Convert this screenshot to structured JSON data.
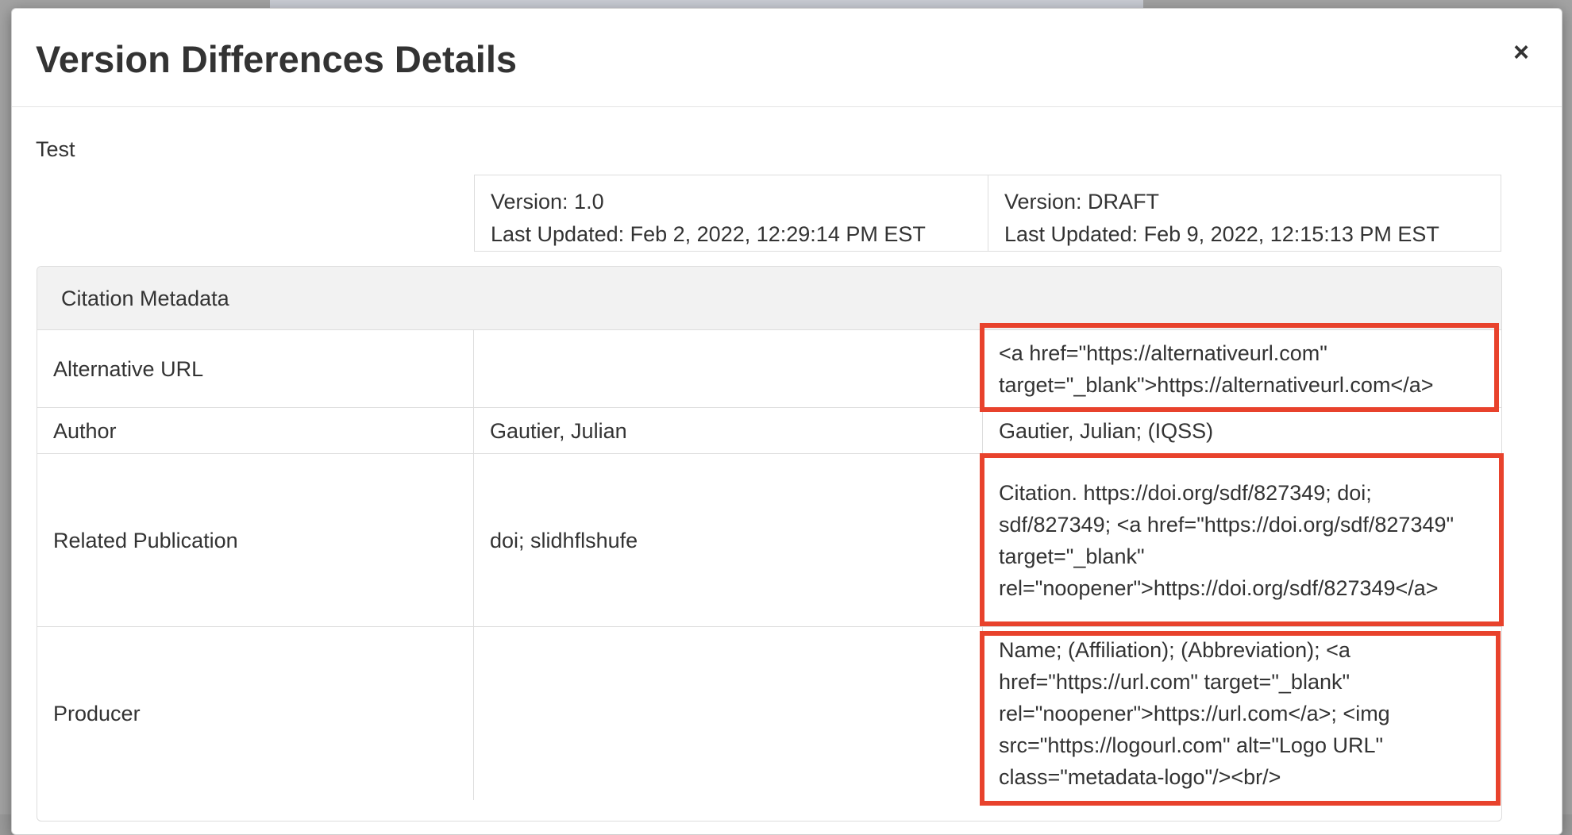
{
  "modal": {
    "title": "Version Differences Details",
    "close_label": "×",
    "dataset_name": "Test"
  },
  "versions": [
    {
      "version_line": "Version: 1.0",
      "updated_line": "Last Updated: Feb 2, 2022, 12:29:14 PM EST"
    },
    {
      "version_line": "Version: DRAFT",
      "updated_line": "Last Updated: Feb 9, 2022, 12:15:13 PM EST"
    }
  ],
  "section": {
    "heading": "Citation Metadata",
    "rows": [
      {
        "label": "Alternative URL",
        "old": "",
        "new": "<a href=\"https://alternativeurl.com\" target=\"_blank\">https://alternativeurl.com</a>",
        "highlighted": true
      },
      {
        "label": "Author",
        "old": "Gautier, Julian",
        "new": "Gautier, Julian; (IQSS)",
        "highlighted": false
      },
      {
        "label": "Related Publication",
        "old": "doi; slidhflshufe",
        "new": "Citation. https://doi.org/sdf/827349; doi; sdf/827349; <a href=\"https://doi.org/sdf/827349\" target=\"_blank\" rel=\"noopener\">https://doi.org/sdf/827349</a>",
        "highlighted": true
      },
      {
        "label": "Producer",
        "old": "",
        "new": "Name; (Affiliation); (Abbreviation); <a href=\"https://url.com\" target=\"_blank\" rel=\"noopener\">https://url.com</a>; <img src=\"https://logourl.com\" alt=\"Logo URL\" class=\"metadata-logo\"/><br/>",
        "highlighted": true
      }
    ]
  },
  "colors": {
    "highlight_border": "#e8422c",
    "panel_heading_bg": "#f2f2f2"
  }
}
